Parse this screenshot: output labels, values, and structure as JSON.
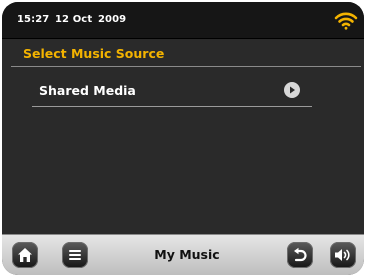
{
  "status_bar": {
    "time": "15:27",
    "date": "12 Oct",
    "year": "2009",
    "wifi_icon": "wifi-signal-icon",
    "wifi_color": "#f3b300"
  },
  "screen": {
    "title": "Select Music Source",
    "title_color": "#f3b300",
    "items": [
      {
        "label": "Shared Media",
        "icon": "chevron-right-icon"
      }
    ]
  },
  "bottom_bar": {
    "title": "My Music",
    "buttons": [
      {
        "name": "home",
        "icon": "home-icon"
      },
      {
        "name": "menu",
        "icon": "list-icon"
      },
      {
        "name": "back",
        "icon": "back-icon"
      },
      {
        "name": "volume",
        "icon": "volume-icon"
      }
    ]
  }
}
